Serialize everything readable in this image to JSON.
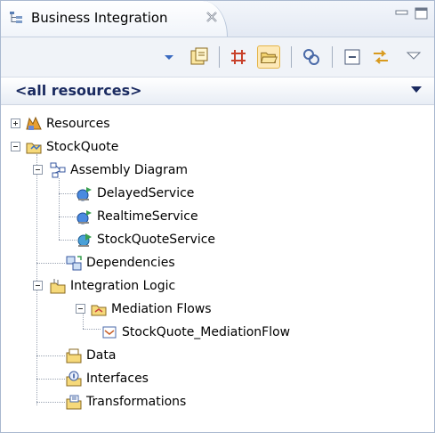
{
  "view": {
    "title": "Business Integration",
    "icons": {
      "tab": "business-integration-icon",
      "close": "close-icon",
      "minimize": "minimize-icon",
      "maximize": "maximize-icon"
    }
  },
  "toolbar": {
    "buttons": [
      {
        "icon": "star-dropdown-icon"
      },
      {
        "icon": "new-module-icon"
      },
      {
        "icon": "grid-icon"
      },
      {
        "icon": "open-folder-icon",
        "active": true
      },
      {
        "icon": "link-chain-icon"
      },
      {
        "icon": "collapse-all-icon"
      },
      {
        "icon": "link-with-editor-icon"
      },
      {
        "icon": "view-menu-icon"
      }
    ]
  },
  "filter": {
    "label": "<all resources>"
  },
  "tree": {
    "resources": "Resources",
    "stockquote": "StockQuote",
    "assembly_diagram": "Assembly Diagram",
    "delayed_service": "DelayedService",
    "realtime_service": "RealtimeService",
    "stockquote_service": "StockQuoteService",
    "dependencies": "Dependencies",
    "integration_logic": "Integration Logic",
    "mediation_flows": "Mediation Flows",
    "mediation_flow": "StockQuote_MediationFlow",
    "data": "Data",
    "interfaces": "Interfaces",
    "transformations": "Transformations"
  }
}
